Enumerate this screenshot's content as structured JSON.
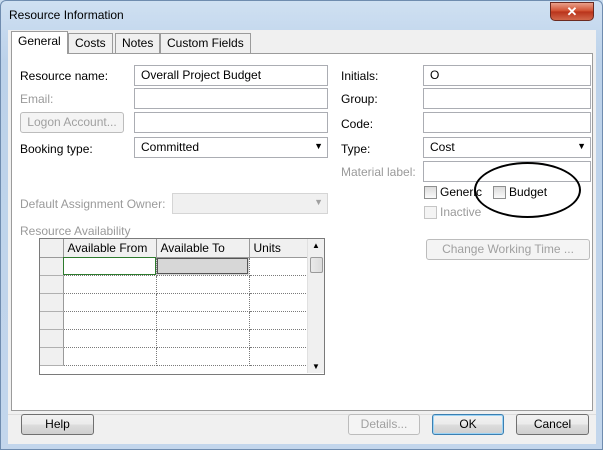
{
  "window": {
    "title": "Resource Information",
    "close_glyph": "✕"
  },
  "tabs": [
    {
      "label": "General",
      "active": true
    },
    {
      "label": "Costs",
      "active": false
    },
    {
      "label": "Notes",
      "active": false
    },
    {
      "label": "Custom Fields",
      "active": false
    }
  ],
  "form": {
    "resource_name_label": "Resource name:",
    "resource_name_value": "Overall Project Budget",
    "email_label": "Email:",
    "email_value": "",
    "logon_account_button": "Logon Account...",
    "logon_account_value": "",
    "booking_type_label": "Booking type:",
    "booking_type_value": "Committed",
    "initials_label": "Initials:",
    "initials_value": "O",
    "group_label": "Group:",
    "group_value": "",
    "code_label": "Code:",
    "code_value": "",
    "type_label": "Type:",
    "type_value": "Cost",
    "material_label_label": "Material label:",
    "material_label_value": "",
    "generic_label": "Generic",
    "generic_checked": false,
    "budget_label": "Budget",
    "budget_checked": false,
    "inactive_label": "Inactive",
    "inactive_checked": false,
    "default_owner_label": "Default Assignment Owner:",
    "default_owner_value": "",
    "resource_availability_label": "Resource Availability",
    "change_working_time_button": "Change Working Time ..."
  },
  "availability_table": {
    "columns": [
      "",
      "Available From",
      "Available To",
      "Units"
    ],
    "rows": [
      [
        "",
        "",
        "",
        ""
      ],
      [
        "",
        "",
        "",
        ""
      ],
      [
        "",
        "",
        "",
        ""
      ],
      [
        "",
        "",
        "",
        ""
      ],
      [
        "",
        "",
        "",
        ""
      ],
      [
        "",
        "",
        "",
        ""
      ]
    ]
  },
  "buttons": {
    "help": "Help",
    "details": "Details...",
    "ok": "OK",
    "cancel": "Cancel"
  }
}
